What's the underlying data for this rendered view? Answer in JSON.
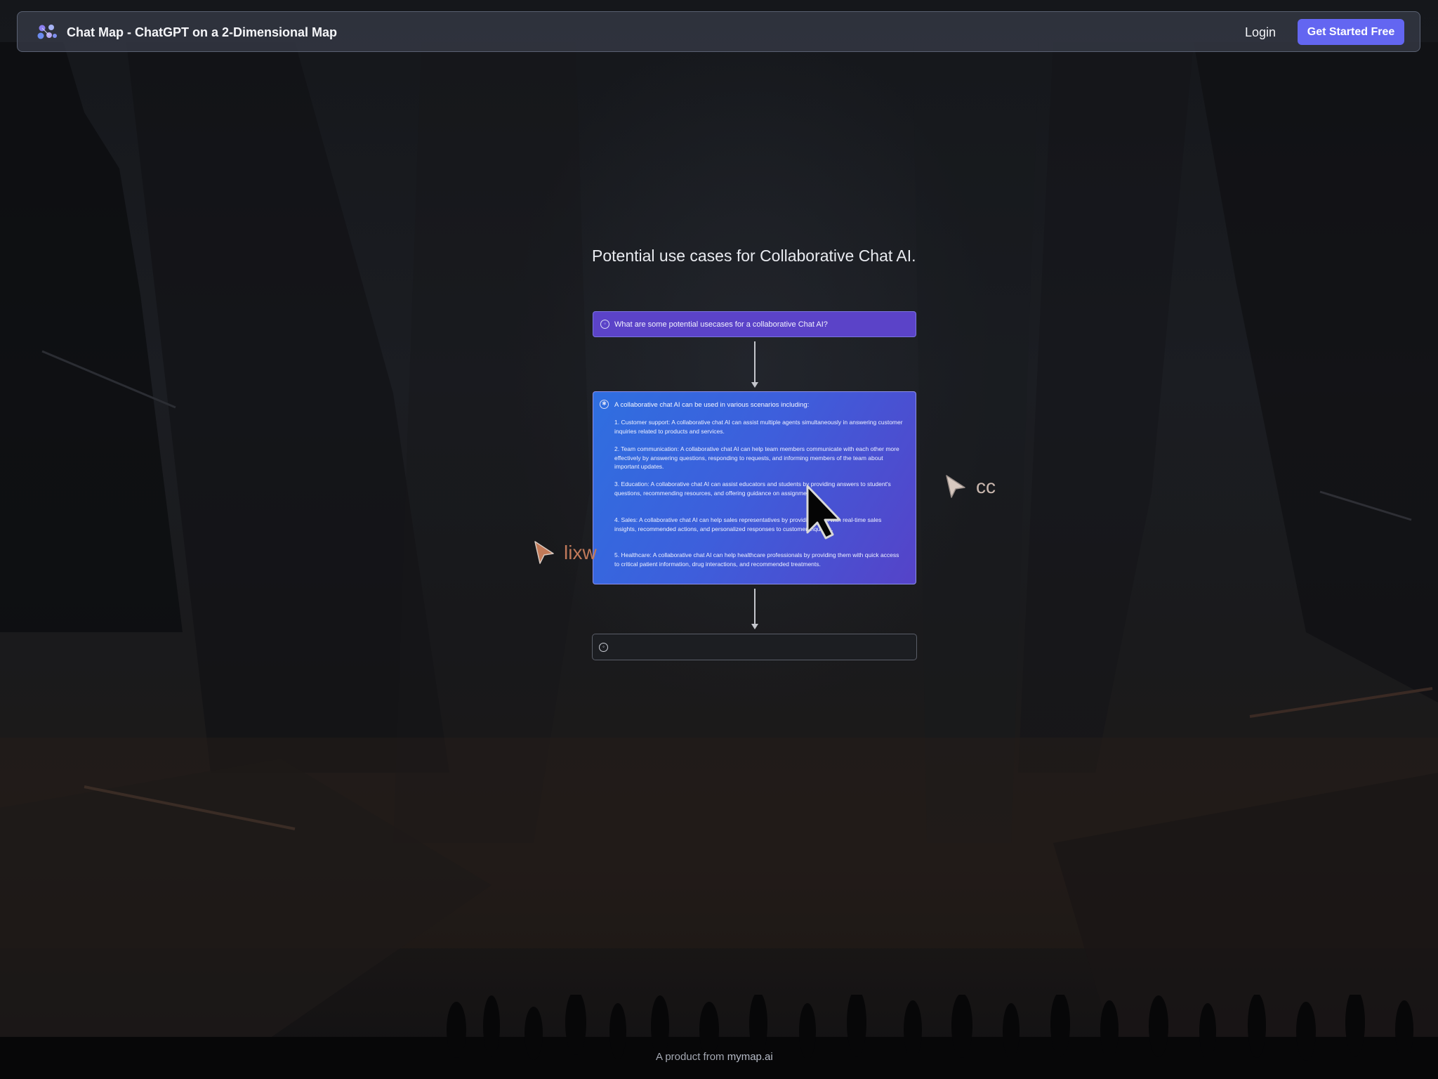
{
  "header": {
    "title": "Chat Map - ChatGPT on a 2-Dimensional Map",
    "login_label": "Login",
    "cta_label": "Get Started Free",
    "accent_color": "#6366f1"
  },
  "map": {
    "title": "Potential use cases for Collaborative Chat AI.",
    "question_node": {
      "text": "What are some potential usecases for a collaborative Chat AI?"
    },
    "answer_node": {
      "intro": "A collaborative chat AI can be used in various scenarios including:",
      "items": [
        "1. Customer support: A collaborative chat AI can assist multiple agents simultaneously in answering customer inquiries related to products and services.",
        "2. Team communication: A collaborative chat AI can help team members communicate with each other more effectively by answering questions, responding to requests, and informing members of the team about important updates.",
        "3. Education: A collaborative chat AI can assist educators and students by providing answers to student's questions, recommending resources, and offering guidance on assignments.",
        "4. Sales: A collaborative chat AI can help sales representatives by providing them with real-time sales insights, recommended actions, and personalized responses to customer inquiries.",
        "5. Healthcare: A collaborative chat AI can help healthcare professionals by providing them with quick access to critical patient information, drug interactions, and recommended treatments."
      ]
    },
    "input_node": {
      "value": ""
    }
  },
  "cursors": [
    {
      "label": "cc",
      "color": "#c9b7ae"
    },
    {
      "label": "lixw",
      "color": "#c0795a"
    }
  ],
  "footer": {
    "prefix": "A product from ",
    "link": "mymap.ai"
  }
}
